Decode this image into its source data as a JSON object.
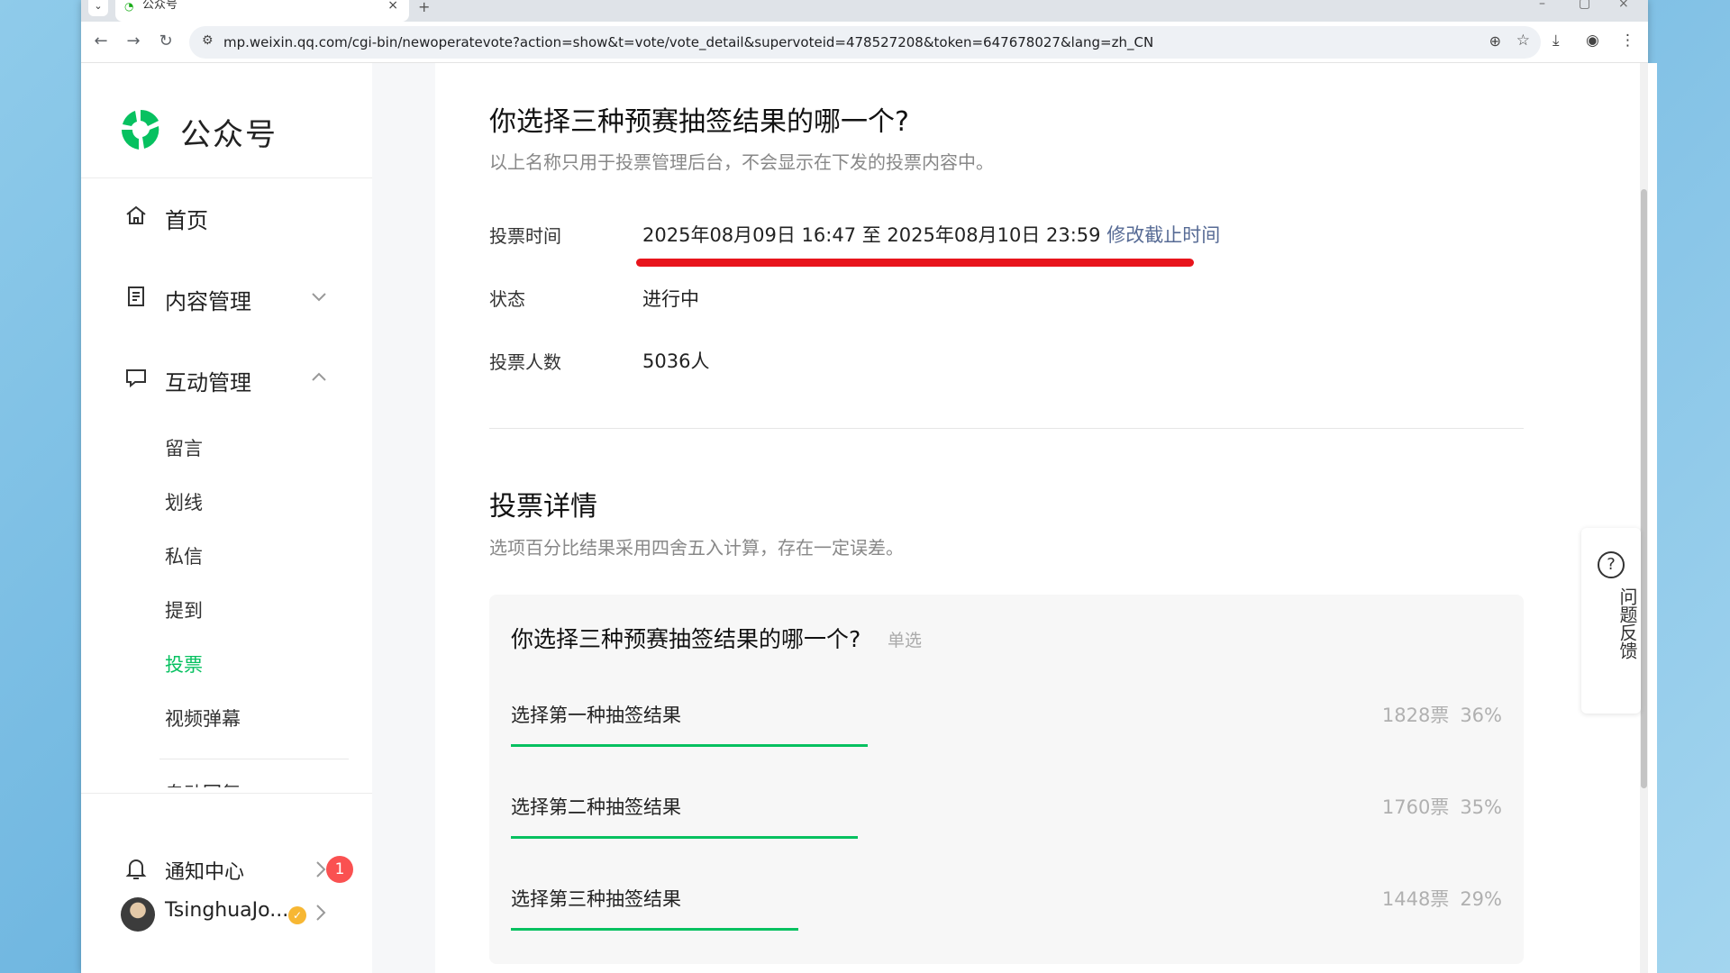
{
  "browser": {
    "tab_title": "公众号",
    "url": "mp.weixin.qq.com/cgi-bin/newoperatevote?action=show&t=vote/vote_detail&supervoteid=478527208&token=647678027&lang=zh_CN"
  },
  "sidebar": {
    "brand": "公众号",
    "nav": [
      {
        "label": "首页",
        "icon": "home-icon"
      },
      {
        "label": "内容管理",
        "icon": "document-icon"
      },
      {
        "label": "互动管理",
        "icon": "chat-icon"
      }
    ],
    "sub_items": [
      "留言",
      "划线",
      "私信",
      "提到",
      "投票",
      "视频弹幕"
    ],
    "active_sub": "投票",
    "cut_item": "自动回复",
    "notification_label": "通知中心",
    "notification_count": "1",
    "account_name": "TsinghuaJo..."
  },
  "vote": {
    "title": "你选择三种预赛抽签结果的哪一个?",
    "subtitle": "以上名称只用于投票管理后台，不会显示在下发的投票内容中。",
    "time_label": "投票时间",
    "time_value": "2025年08月09日 16:47 至 2025年08月10日 23:59",
    "modify_link": "修改截止时间",
    "status_label": "状态",
    "status_value": "进行中",
    "count_label": "投票人数",
    "count_value": "5036人"
  },
  "details": {
    "title": "投票详情",
    "subtitle": "选项百分比结果采用四舍五入计算，存在一定误差。",
    "question": "你选择三种预赛抽签结果的哪一个?",
    "question_type": "单选",
    "options": [
      {
        "label": "选择第一种抽签结果",
        "votes": "1828票",
        "percent": "36%",
        "share": 36
      },
      {
        "label": "选择第二种抽签结果",
        "votes": "1760票",
        "percent": "35%",
        "share": 35
      },
      {
        "label": "选择第三种抽签结果",
        "votes": "1448票",
        "percent": "29%",
        "share": 29
      }
    ]
  },
  "feedback": {
    "label": "问题反馈"
  },
  "colors": {
    "accent": "#07c160",
    "link": "#576b95",
    "highlight": "#e8141c",
    "badge": "#fa5151"
  }
}
